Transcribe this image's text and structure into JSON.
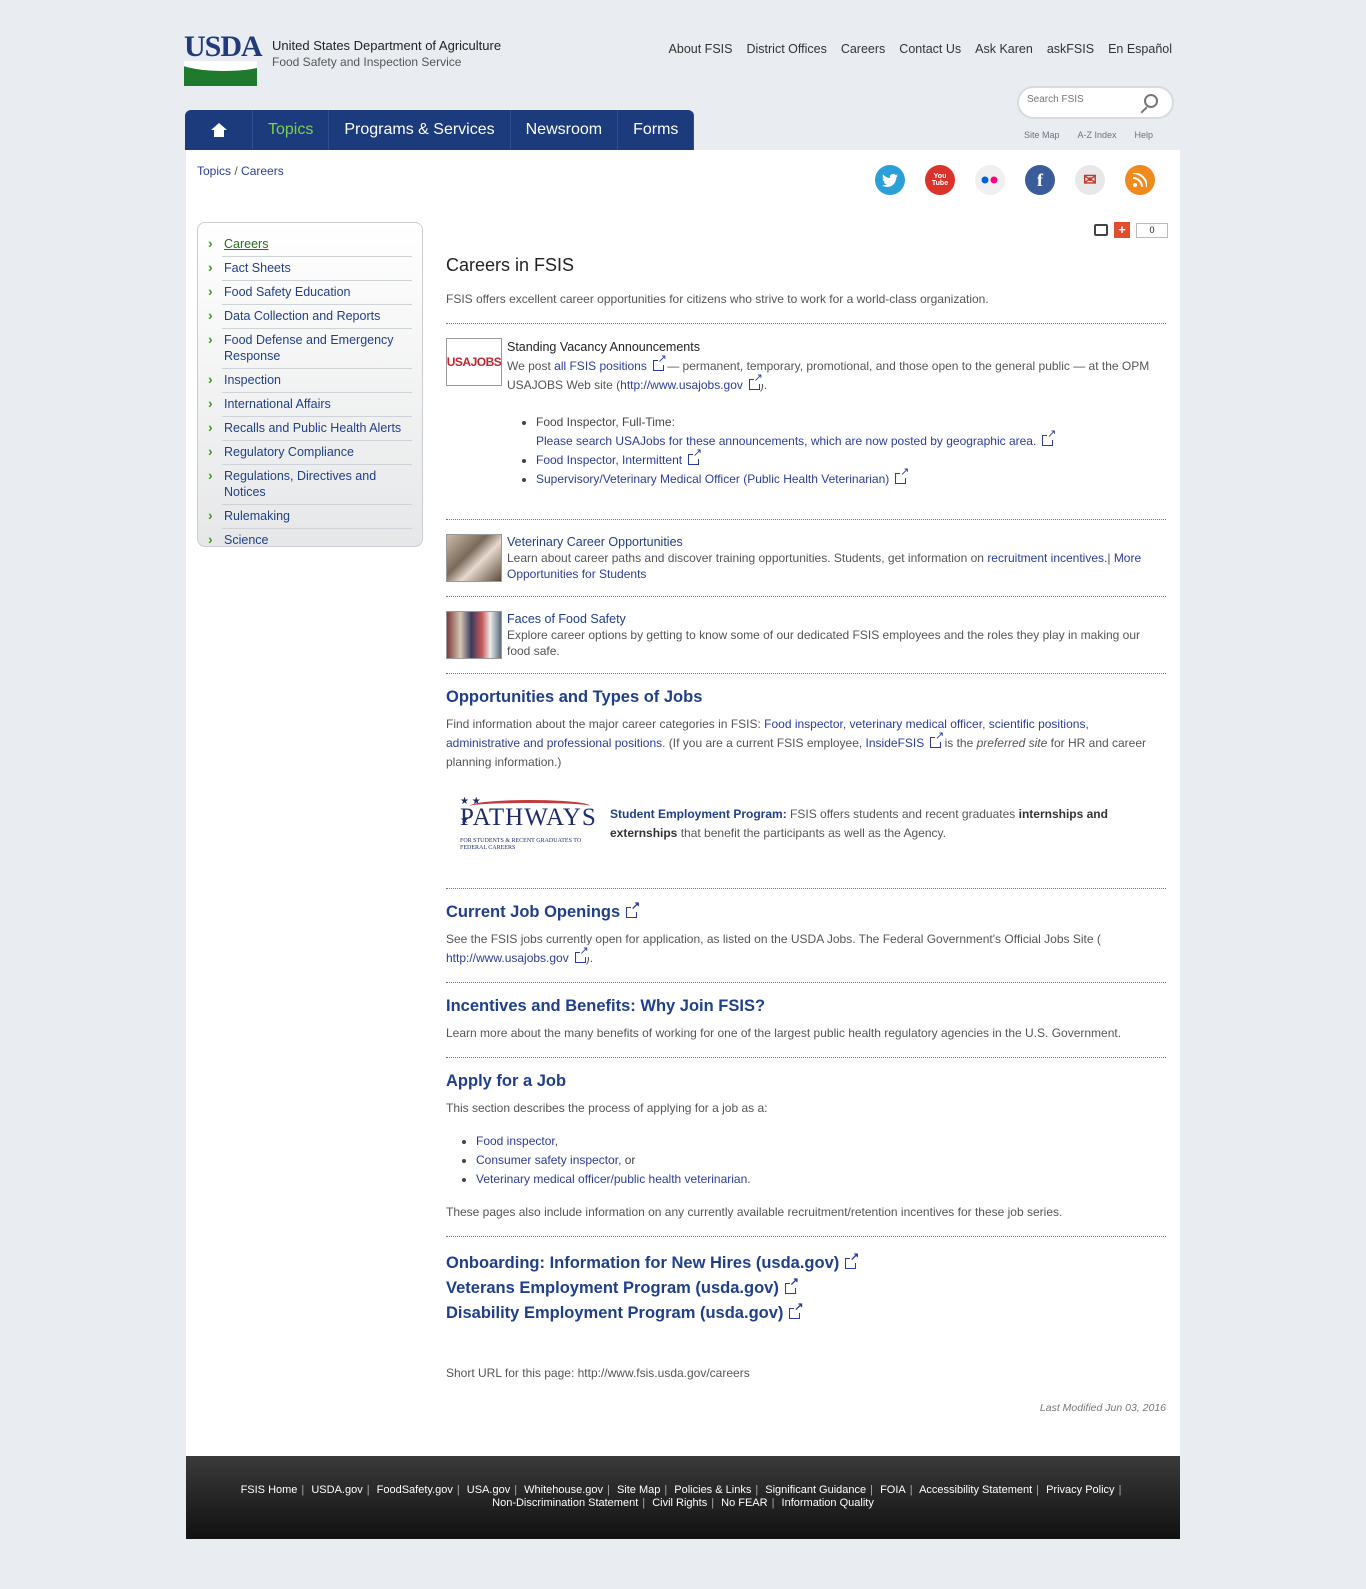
{
  "header": {
    "logo": "USDA",
    "agency_line1": "United States Department of Agriculture",
    "agency_line2": "Food Safety and Inspection Service",
    "util_nav": [
      "About FSIS",
      "District Offices",
      "Careers",
      "Contact Us",
      "Ask Karen",
      "askFSIS",
      "En Español"
    ],
    "search_placeholder": "Search FSIS",
    "mini_links": [
      "Site Map",
      "A-Z Index",
      "Help"
    ]
  },
  "topnav": [
    "Topics",
    "Programs & Services",
    "Newsroom",
    "Forms"
  ],
  "breadcrumb": [
    "Topics",
    "Careers"
  ],
  "social": [
    {
      "icon": "twitter-icon",
      "label": "",
      "color": "#2a9fd8"
    },
    {
      "icon": "youtube-icon",
      "label": "You Tube",
      "color": "#d9332b"
    },
    {
      "icon": "flickr-icon",
      "label": "●●",
      "color": "#f0f0f0"
    },
    {
      "icon": "facebook-icon",
      "label": "f",
      "color": "#3b5c9a"
    },
    {
      "icon": "email-icon",
      "label": "✉",
      "color": "#c0392b"
    },
    {
      "icon": "rss-icon",
      "label": "",
      "color": "#ef8a1e"
    }
  ],
  "sidebar": [
    "Careers",
    "Fact Sheets",
    "Food Safety Education",
    "Data Collection and Reports",
    "Food Defense and Emergency Response",
    "Inspection",
    "International Affairs",
    "Recalls and Public Health Alerts",
    "Regulatory Compliance",
    "Regulations, Directives and Notices",
    "Rulemaking",
    "Science"
  ],
  "share_count": "0",
  "main": {
    "title": "Careers in FSIS",
    "intro": "FSIS offers excellent career opportunities for citizens who strive to work for a world-class organization.",
    "usajobs_logo": "USAJOBS",
    "vacancy_title": "Standing Vacancy Announcements",
    "vacancy_text1": "We post ",
    "vacancy_link": "all FSIS positions",
    "vacancy_text2": " — permanent, temporary, promotional, and those open to the general public — at the OPM USAJOBS Web site (",
    "vacancy_url": "http://www.usajobs.gov",
    "vacancy_text3": ").",
    "job1_label": "Food Inspector, Full-Time:",
    "job1_link": "Please search USAJobs for these announcements, which are now posted by geographic area.",
    "job2": "Food Inspector, Intermittent",
    "job3": "Supervisory/Veterinary Medical Officer (Public Health Veterinarian)",
    "vet_title": "Veterinary Career Opportunities",
    "vet_text": "Learn about career paths and discover training opportunities. Students, get information on ",
    "vet_link1": "recruitment incentives.",
    "vet_sep": "| ",
    "vet_link2": "More Opportunities for Students",
    "faces_title": "Faces of Food Safety",
    "faces_text": "Explore career options by getting to know some of our dedicated FSIS employees and the roles they play in making our food safe.",
    "opps_heading": "Opportunities and Types of Jobs",
    "opps_text1": "Find information about the major career categories in FSIS: ",
    "opps_link1": "Food inspector",
    "opps_link2": "veterinary medical officer",
    "opps_link3": "scientific positions",
    "opps_link4": "administrative and professional positions",
    "opps_text2": ". (If you are a current FSIS employee, ",
    "opps_link5": "InsideFSIS",
    "opps_text3": " is the ",
    "opps_em": "preferred site",
    "opps_text4": " for HR and career planning information.)",
    "pathways_word": "PATHWAYS",
    "pathways_sub": "FOR STUDENTS & RECENT GRADUATES TO FEDERAL CAREERS",
    "sep_title": "Student Employment Program:",
    "sep_text1": " FSIS offers students and recent graduates ",
    "sep_bold": "internships and externships",
    "sep_text2": " that benefit the participants as well as the Agency.",
    "current_heading": "Current Job Openings",
    "current_text": "See the FSIS jobs currently open for application, as listed on the USDA Jobs. The Federal Government's Official Jobs Site (",
    "current_url": "http://www.usajobs.gov",
    "current_close": ").",
    "incent_heading": "Incentives and Benefits: Why Join FSIS?",
    "incent_text": "Learn more about the many benefits of working for one of the largest public health regulatory agencies in the U.S. Government.",
    "apply_heading": "Apply for a Job",
    "apply_text": "This section describes the process of applying for a job as a:",
    "apply_items": [
      "Food inspector",
      "Consumer safety inspector",
      "Veterinary medical officer/public health veterinarian"
    ],
    "apply_suffix": [
      ",",
      ", or",
      "."
    ],
    "apply_note": "These pages also include information on any currently available recruitment/retention incentives for these job series.",
    "big_links": [
      "Onboarding: Information for New Hires (usda.gov)",
      "Veterans Employment Program (usda.gov)",
      "Disability Employment Program (usda.gov)"
    ],
    "short_url": "Short URL for this page: http://www.fsis.usda.gov/careers",
    "last_modified": "Last Modified Jun 03, 2016"
  },
  "footer": {
    "row1": [
      "FSIS Home",
      "USDA.gov",
      "FoodSafety.gov",
      "USA.gov",
      "Whitehouse.gov",
      "Site Map",
      "Policies & Links",
      "Significant Guidance",
      "FOIA",
      "Accessibility Statement",
      "Privacy Policy"
    ],
    "row2": [
      "Non-Discrimination Statement",
      "Civil Rights",
      "No FEAR",
      "Information Quality"
    ]
  }
}
